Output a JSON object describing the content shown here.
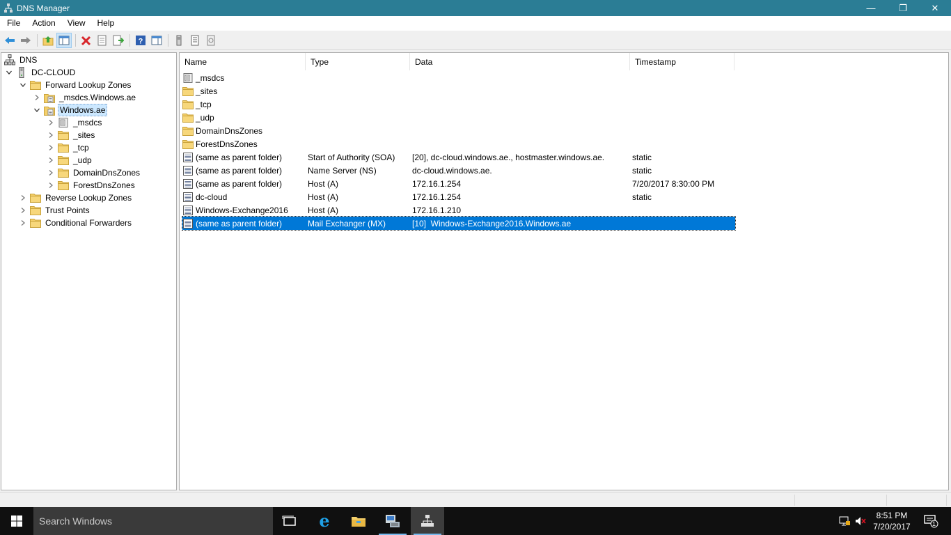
{
  "window": {
    "title": "DNS Manager",
    "minimize_glyph": "—",
    "maximize_glyph": "❐",
    "close_glyph": "✕"
  },
  "menu": [
    "File",
    "Action",
    "View",
    "Help"
  ],
  "toolbar": [
    {
      "name": "back-icon"
    },
    {
      "name": "forward-icon"
    },
    {
      "name": "up-folder-icon"
    },
    {
      "name": "show-hide-console-tree-icon"
    },
    {
      "name": "delete-icon"
    },
    {
      "name": "properties-icon"
    },
    {
      "name": "export-list-icon"
    },
    {
      "name": "help-icon"
    },
    {
      "name": "show-action-pane-icon"
    },
    {
      "name": "server-icon"
    },
    {
      "name": "zone-list-icon"
    },
    {
      "name": "record-icon"
    }
  ],
  "tree": [
    {
      "label": "DNS",
      "level": 0,
      "icon": "dns-root-icon",
      "expander": "none"
    },
    {
      "label": "DC-CLOUD",
      "level": 1,
      "icon": "server-icon",
      "expander": "expanded"
    },
    {
      "label": "Forward Lookup Zones",
      "level": 2,
      "icon": "folder-icon",
      "expander": "expanded"
    },
    {
      "label": "_msdcs.Windows.ae",
      "level": 3,
      "icon": "zone-icon",
      "expander": "collapsed"
    },
    {
      "label": "Windows.ae",
      "level": 3,
      "icon": "zone-icon",
      "expander": "expanded",
      "selected": true
    },
    {
      "label": "_msdcs",
      "level": 4,
      "icon": "delegation-icon",
      "expander": "collapsed"
    },
    {
      "label": "_sites",
      "level": 4,
      "icon": "folder-icon",
      "expander": "collapsed"
    },
    {
      "label": "_tcp",
      "level": 4,
      "icon": "folder-icon",
      "expander": "collapsed"
    },
    {
      "label": "_udp",
      "level": 4,
      "icon": "folder-icon",
      "expander": "collapsed"
    },
    {
      "label": "DomainDnsZones",
      "level": 4,
      "icon": "folder-icon",
      "expander": "collapsed"
    },
    {
      "label": "ForestDnsZones",
      "level": 4,
      "icon": "folder-icon",
      "expander": "collapsed"
    },
    {
      "label": "Reverse Lookup Zones",
      "level": 2,
      "icon": "folder-icon",
      "expander": "collapsed"
    },
    {
      "label": "Trust Points",
      "level": 2,
      "icon": "folder-icon",
      "expander": "collapsed"
    },
    {
      "label": "Conditional Forwarders",
      "level": 2,
      "icon": "folder-icon",
      "expander": "collapsed"
    }
  ],
  "columns": [
    {
      "label": "Name"
    },
    {
      "label": "Type"
    },
    {
      "label": "Data"
    },
    {
      "label": "Timestamp"
    }
  ],
  "records": [
    {
      "icon": "delegation-icon",
      "name": "_msdcs",
      "type": "",
      "data": "",
      "timestamp": ""
    },
    {
      "icon": "folder-icon",
      "name": "_sites",
      "type": "",
      "data": "",
      "timestamp": ""
    },
    {
      "icon": "folder-icon",
      "name": "_tcp",
      "type": "",
      "data": "",
      "timestamp": ""
    },
    {
      "icon": "folder-icon",
      "name": "_udp",
      "type": "",
      "data": "",
      "timestamp": ""
    },
    {
      "icon": "folder-icon",
      "name": "DomainDnsZones",
      "type": "",
      "data": "",
      "timestamp": ""
    },
    {
      "icon": "folder-icon",
      "name": "ForestDnsZones",
      "type": "",
      "data": "",
      "timestamp": ""
    },
    {
      "icon": "record-icon",
      "name": "(same as parent folder)",
      "type": "Start of Authority (SOA)",
      "data": "[20], dc-cloud.windows.ae., hostmaster.windows.ae.",
      "timestamp": "static"
    },
    {
      "icon": "record-icon",
      "name": "(same as parent folder)",
      "type": "Name Server (NS)",
      "data": "dc-cloud.windows.ae.",
      "timestamp": "static"
    },
    {
      "icon": "record-icon",
      "name": "(same as parent folder)",
      "type": "Host (A)",
      "data": "172.16.1.254",
      "timestamp": "7/20/2017 8:30:00 PM"
    },
    {
      "icon": "record-icon",
      "name": "dc-cloud",
      "type": "Host (A)",
      "data": "172.16.1.254",
      "timestamp": "static"
    },
    {
      "icon": "record-icon",
      "name": "Windows-Exchange2016",
      "type": "Host (A)",
      "data": "172.16.1.210",
      "timestamp": ""
    },
    {
      "icon": "record-icon",
      "name": "(same as parent folder)",
      "type": "Mail Exchanger (MX)",
      "data": "[10]  Windows-Exchange2016.Windows.ae",
      "timestamp": "",
      "selected": true
    }
  ],
  "taskbar": {
    "search_placeholder": "Search Windows",
    "apps": [
      {
        "name": "task-view-icon"
      },
      {
        "name": "edge-browser-icon"
      },
      {
        "name": "file-explorer-icon"
      },
      {
        "name": "server-manager-icon",
        "running": true
      },
      {
        "name": "dns-manager-icon",
        "running": true,
        "active": true
      }
    ],
    "clock_time": "8:51 PM",
    "clock_date": "7/20/2017",
    "notification_count": "1"
  },
  "colors": {
    "titlebar": "#2b7d95",
    "selection": "#0078d7",
    "folder": "#f4cf6a",
    "taskbar": "#101010"
  }
}
